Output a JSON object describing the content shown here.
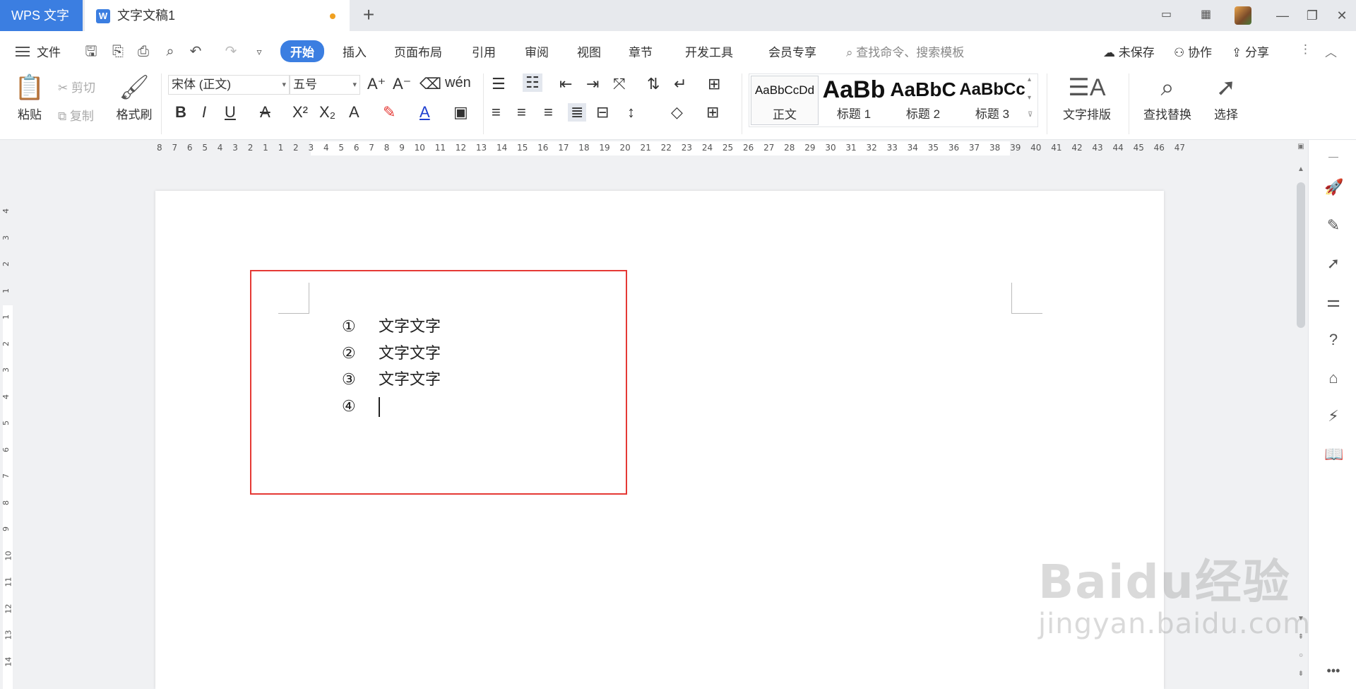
{
  "titlebar": {
    "app_tab": "WPS 文字",
    "doc_title": "文字文稿1",
    "new_tab": "+"
  },
  "menubar": {
    "file": "文件",
    "tabs": [
      "开始",
      "插入",
      "页面布局",
      "引用",
      "审阅",
      "视图",
      "章节",
      "开发工具",
      "会员专享"
    ],
    "search_placeholder": "查找命令、搜索模板",
    "unsaved": "未保存",
    "collab": "协作",
    "share": "分享"
  },
  "ribbon": {
    "paste": "粘贴",
    "cut": "剪切",
    "copy": "复制",
    "format_painter": "格式刷",
    "font_name": "宋体 (正文)",
    "font_size": "五号",
    "styles": [
      {
        "preview": "AaBbCcDd",
        "label": "正文"
      },
      {
        "preview": "AaBb",
        "label": "标题 1"
      },
      {
        "preview": "AaBbC",
        "label": "标题 2"
      },
      {
        "preview": "AaBbCc",
        "label": "标题 3"
      }
    ],
    "text_layout": "文字排版",
    "find_replace": "查找替换",
    "select": "选择"
  },
  "ruler": {
    "numbers": "8 7 6 5 4 3 2 1 1 2 3 4 5 6 7 8 9 10 11 12 13 14 15 16 17 18 19 20 21 22 23 24 25 26 27 28 29 30 31 32 33 34 35 36 37 38 39 40 41 42 43 44 45 46 47"
  },
  "vruler": [
    "4",
    "3",
    "2",
    "1",
    "1",
    "2",
    "3",
    "4",
    "5",
    "6",
    "7",
    "8",
    "9",
    "10",
    "11",
    "12",
    "13",
    "14"
  ],
  "document": {
    "list": [
      {
        "marker": "①",
        "text": "文字文字"
      },
      {
        "marker": "②",
        "text": "文字文字"
      },
      {
        "marker": "③",
        "text": "文字文字"
      },
      {
        "marker": "④",
        "text": ""
      }
    ]
  },
  "watermark": {
    "main": "Baidu经验",
    "sub": "jingyan.baidu.com"
  },
  "colors": {
    "accent": "#3b7ee1",
    "highlight_border": "#e53935",
    "unsaved_dot": "#f0a020"
  }
}
